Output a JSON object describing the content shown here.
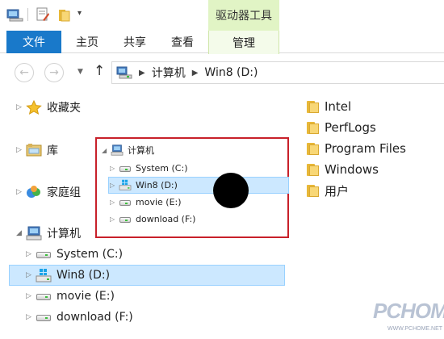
{
  "window": {
    "context_tab_title": "驱动器工具"
  },
  "ribbon": {
    "tabs": [
      {
        "label": "文件"
      },
      {
        "label": "主页"
      },
      {
        "label": "共享"
      },
      {
        "label": "查看"
      },
      {
        "label": "管理"
      }
    ]
  },
  "address": {
    "crumbs": [
      "计算机",
      "Win8 (D:)"
    ]
  },
  "nav": {
    "favorites": "收藏夹",
    "libraries": "库",
    "homegroup": "家庭组",
    "computer": "计算机",
    "drives": [
      {
        "label": "System (C:)"
      },
      {
        "label": "Win8 (D:)"
      },
      {
        "label": "movie (E:)"
      },
      {
        "label": "download (F:)"
      }
    ]
  },
  "content": {
    "items": [
      {
        "name": "Intel"
      },
      {
        "name": "PerfLogs"
      },
      {
        "name": "Program Files"
      },
      {
        "name": "Windows"
      },
      {
        "name": "用户"
      }
    ]
  },
  "popup": {
    "computer": "计算机",
    "drives": [
      {
        "label": "System (C:)"
      },
      {
        "label": "Win8 (D:)"
      },
      {
        "label": "movie (E:)"
      },
      {
        "label": "download (F:)"
      }
    ]
  },
  "watermark": {
    "logo": "PCHOME",
    "url": "WWW.PCHOME.NET"
  },
  "colors": {
    "file_tab": "#1979ca",
    "context_tab": "#e1f4c5",
    "selection": "#cce8ff",
    "callout_border": "#c8202a",
    "folder": "#f8d776"
  }
}
